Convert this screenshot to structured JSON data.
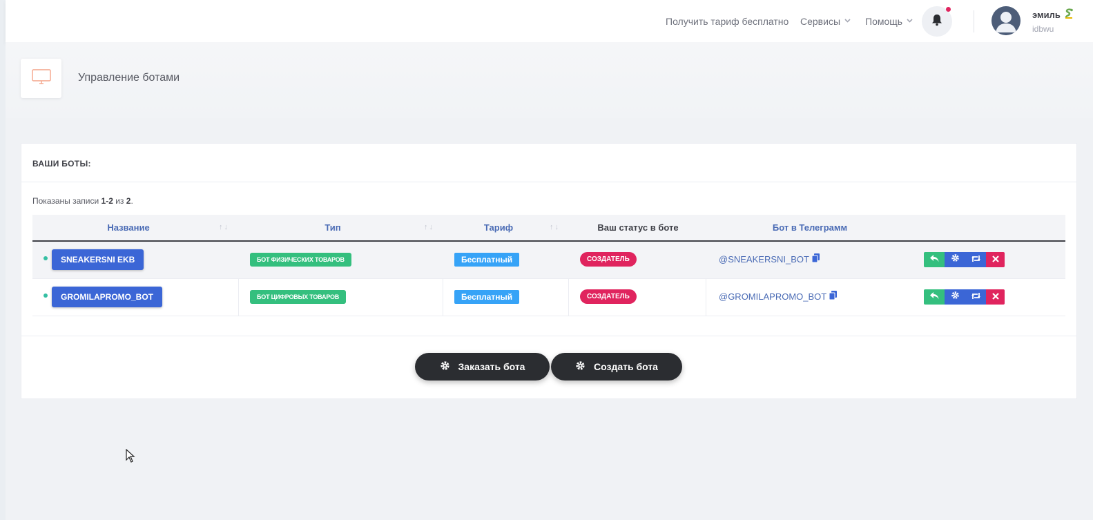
{
  "nav": {
    "free_tariff": "Получить тариф бесплатно",
    "services": "Сервисы",
    "help": "Помощь"
  },
  "user": {
    "name": "эмиль",
    "login": "idbwu"
  },
  "page": {
    "title": "Управление ботами"
  },
  "panel": {
    "title": "ВАШИ БОТЫ:",
    "summary_prefix": "Показаны записи ",
    "summary_range": "1-2",
    "summary_mid": " из ",
    "summary_total": "2",
    "summary_suffix": "."
  },
  "table": {
    "headers": {
      "name": "Название",
      "type": "Тип",
      "tariff": "Тариф",
      "status": "Ваш статус в боте",
      "telegram": "Бот в Телеграмм"
    },
    "sort_glyph": "↑↓",
    "rows": [
      {
        "name": "SNEAKERSNI EKB",
        "type": "БОТ ФИЗИЧЕСКИХ ТОВАРОВ",
        "tariff": "Бесплатный",
        "status": "СОЗДАТЕЛЬ",
        "telegram": "@SNEAKERSNI_BOT"
      },
      {
        "name": "GROMILAPROMO_BOT",
        "type": "БОТ ЦИФРОВЫХ ТОВАРОВ",
        "tariff": "Бесплатный",
        "status": "СОЗДАТЕЛЬ",
        "telegram": "@GROMILAPROMO_BOT"
      }
    ]
  },
  "buttons": {
    "order_bot": "Заказать бота",
    "create_bot": "Создать бота"
  },
  "colors": {
    "primary": "#3b66d6",
    "success": "#34bf7e",
    "info": "#36a3f7",
    "danger": "#e0245e",
    "dark": "#2b2d31"
  },
  "icons": {
    "notification": "bell-icon",
    "monitor": "monitor-icon",
    "copy": "copy-icon",
    "reply": "reply-icon",
    "settings": "gear-icon",
    "refresh": "retweet-icon",
    "delete": "close-icon"
  }
}
